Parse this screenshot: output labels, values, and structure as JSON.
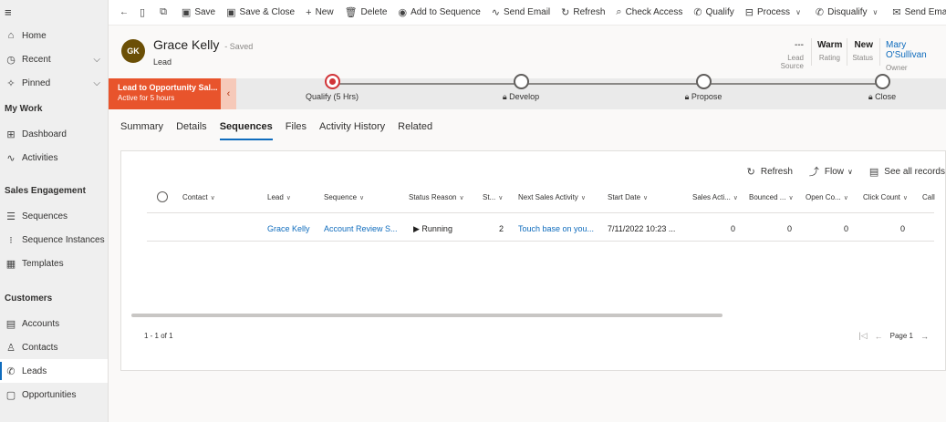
{
  "sidebar": {
    "menu_icon": "hamburger-icon",
    "items_top": [
      {
        "label": "Home",
        "icon": "home-icon"
      },
      {
        "label": "Recent",
        "icon": "clock-icon",
        "chevron": "⌵"
      },
      {
        "label": "Pinned",
        "icon": "pin-icon",
        "chevron": "⌵"
      }
    ],
    "sections": [
      {
        "title": "My Work",
        "items": [
          {
            "label": "Dashboard",
            "icon": "dashboard-icon"
          },
          {
            "label": "Activities",
            "icon": "activity-icon"
          }
        ]
      },
      {
        "title": "Sales Engagement",
        "items": [
          {
            "label": "Sequences",
            "icon": "list-icon"
          },
          {
            "label": "Sequence Instances",
            "icon": "sequence-icon"
          },
          {
            "label": "Templates",
            "icon": "template-icon"
          }
        ]
      },
      {
        "title": "Customers",
        "items": [
          {
            "label": "Accounts",
            "icon": "building-icon"
          },
          {
            "label": "Contacts",
            "icon": "person-icon"
          },
          {
            "label": "Leads",
            "icon": "phone-icon"
          },
          {
            "label": "Opportunities",
            "icon": "opportunity-icon"
          }
        ]
      }
    ]
  },
  "commandbar": {
    "back": "←",
    "items": [
      "Save",
      "Save & Close",
      "New",
      "Delete",
      "Add to Sequence",
      "Send Email",
      "Refresh",
      "Check Access",
      "Qualify",
      "Process",
      "Disqualify",
      "Send Email"
    ],
    "more": "⋮"
  },
  "record": {
    "initials": "GK",
    "name": "Grace Kelly",
    "saved": "- Saved",
    "type": "Lead",
    "fields": [
      {
        "value": "---",
        "label": "Lead Source"
      },
      {
        "value": "Warm",
        "label": "Rating"
      },
      {
        "value": "New",
        "label": "Status"
      },
      {
        "value": "Mary O'Sullivan",
        "label": "Owner"
      }
    ]
  },
  "bpf": {
    "process_name": "Lead to Opportunity Sal...",
    "active_for": "Active for 5 hours",
    "toggle": "‹",
    "stages": [
      {
        "label": "Qualify  (5 Hrs)",
        "current": true,
        "locked": false
      },
      {
        "label": "Develop",
        "current": false,
        "locked": true
      },
      {
        "label": "Propose",
        "current": false,
        "locked": true
      },
      {
        "label": "Close",
        "current": false,
        "locked": true
      }
    ]
  },
  "tabs": [
    "Summary",
    "Details",
    "Sequences",
    "Files",
    "Activity History",
    "Related"
  ],
  "active_tab": "Sequences",
  "grid": {
    "tools": [
      "Refresh",
      "Flow",
      "See all records"
    ],
    "columns": [
      "Contact",
      "Lead",
      "Sequence",
      "Status Reason",
      "St...",
      "Next Sales Activity",
      "Start Date",
      "Sales Acti...",
      "Bounced ...",
      "Open Co...",
      "Click Count",
      "Call"
    ],
    "rows": [
      {
        "contact": "",
        "lead": "Grace Kelly",
        "sequence": "Account Review S...",
        "status": "▶ Running",
        "step": "2",
        "next_activity": "Touch base on you...",
        "start_date": "7/11/2022 10:23 ...",
        "sales_acti": "0",
        "bounced": "0",
        "open_co": "0",
        "click_count": "0",
        "call": ""
      }
    ],
    "count": "1 - 1 of 1",
    "page": "Page 1"
  },
  "colors": {
    "accent": "#0f6cbd",
    "bpf_active": "#e8542c",
    "stage_current": "#d13438"
  }
}
